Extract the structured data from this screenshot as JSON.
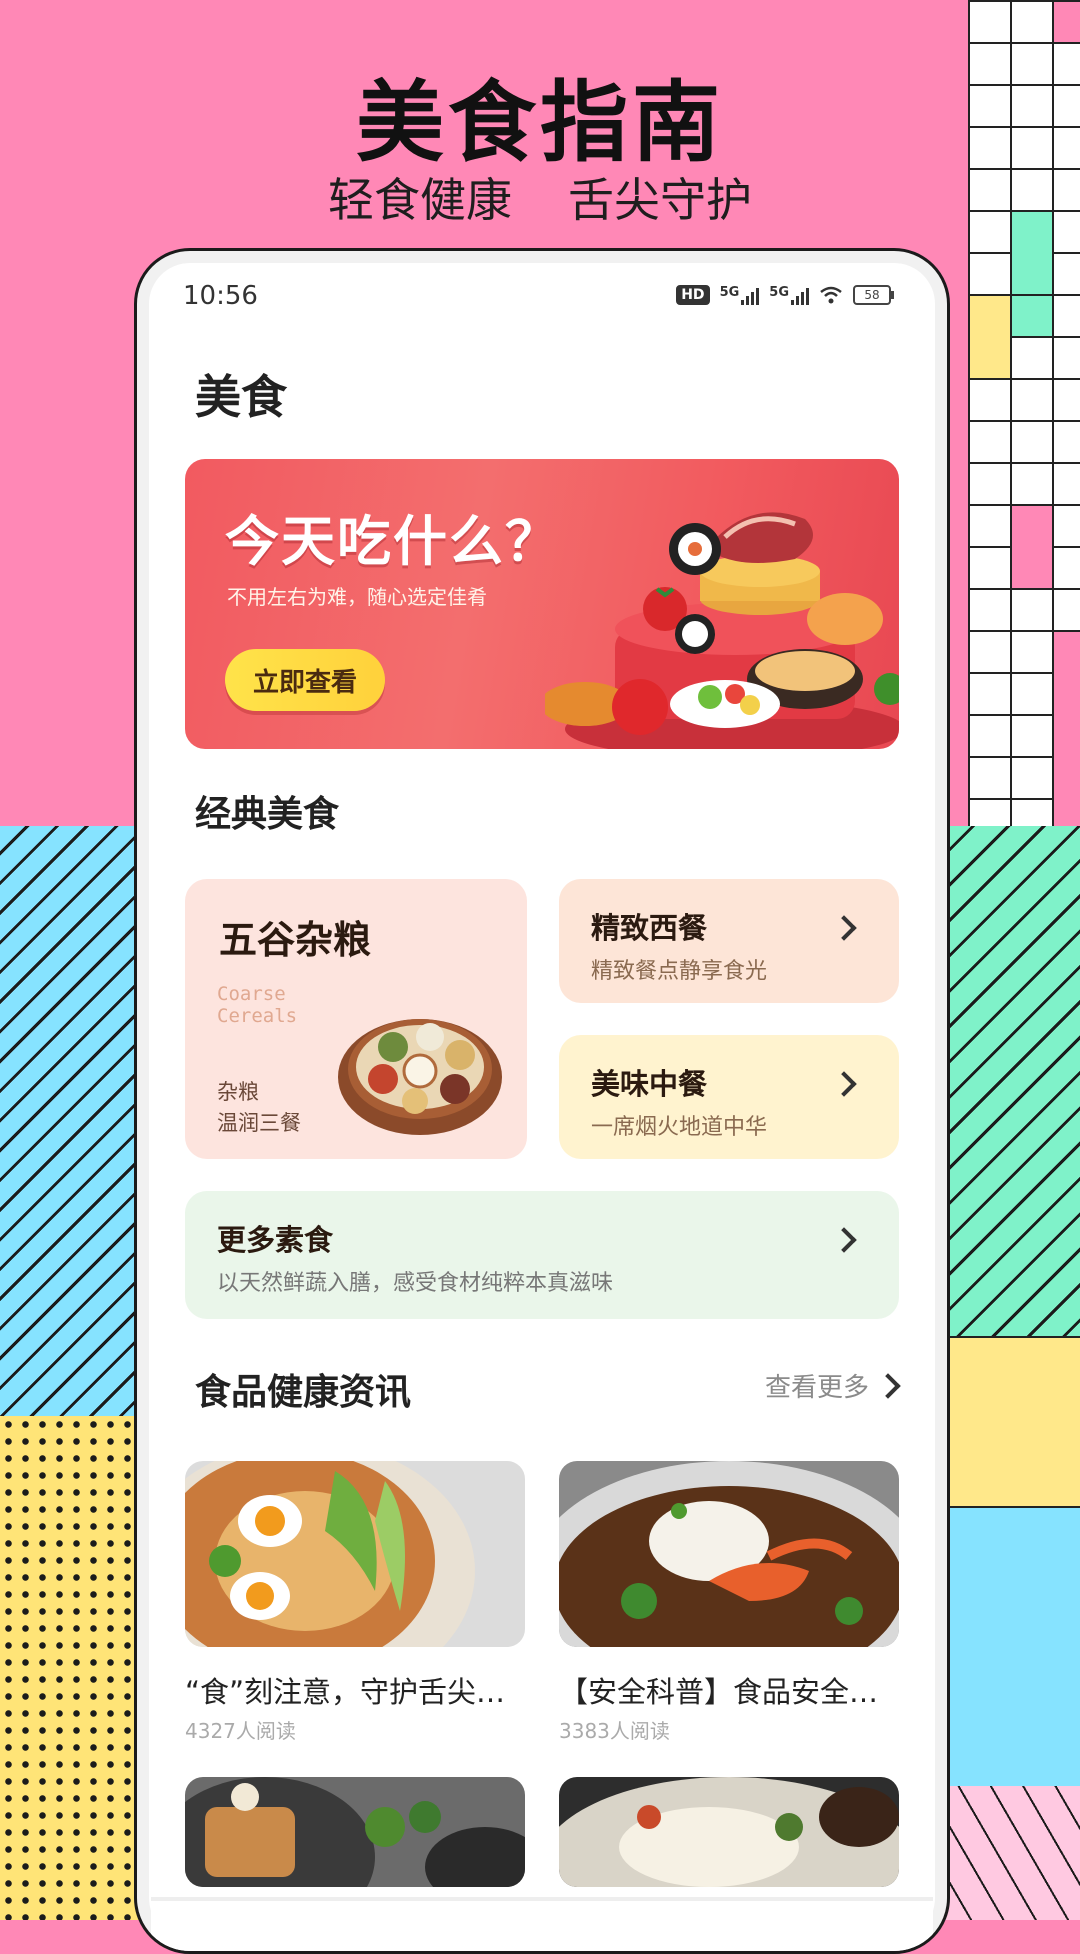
{
  "promo": {
    "title": "美食指南",
    "subtitle_left": "轻食健康",
    "subtitle_right": "舌尖守护"
  },
  "status_bar": {
    "time": "10:56",
    "hd_label": "HD",
    "signal_1_label": "5G",
    "signal_2_label": "5G",
    "battery": "58"
  },
  "page": {
    "title": "美食"
  },
  "banner": {
    "title": "今天吃什么？",
    "subtitle": "不用左右为难，随心选定佳肴",
    "button_label": "立即查看"
  },
  "classic": {
    "section_title": "经典美食",
    "grains": {
      "title": "五谷杂粮",
      "english": "Coarse Cereals",
      "desc_line1": "杂粮",
      "desc_line2": "温润三餐"
    },
    "western": {
      "title": "精致西餐",
      "desc": "精致餐点静享食光"
    },
    "chinese": {
      "title": "美味中餐",
      "desc": "一席烟火地道中华"
    },
    "vegetarian": {
      "title": "更多素食",
      "desc": "以天然鲜蔬入膳，感受食材纯粹本真滋味"
    }
  },
  "news": {
    "section_title": "食品健康资讯",
    "see_more": "查看更多",
    "items": [
      {
        "title": "“食”刻注意，守护舌尖…",
        "reads": "4327人阅读"
      },
      {
        "title": "【安全科普】食品安全…",
        "reads": "3383人阅读"
      }
    ]
  },
  "colors": {
    "background_pink": "#ff88b6",
    "banner_red": "#f25a60",
    "button_yellow": "#ffe34a"
  }
}
